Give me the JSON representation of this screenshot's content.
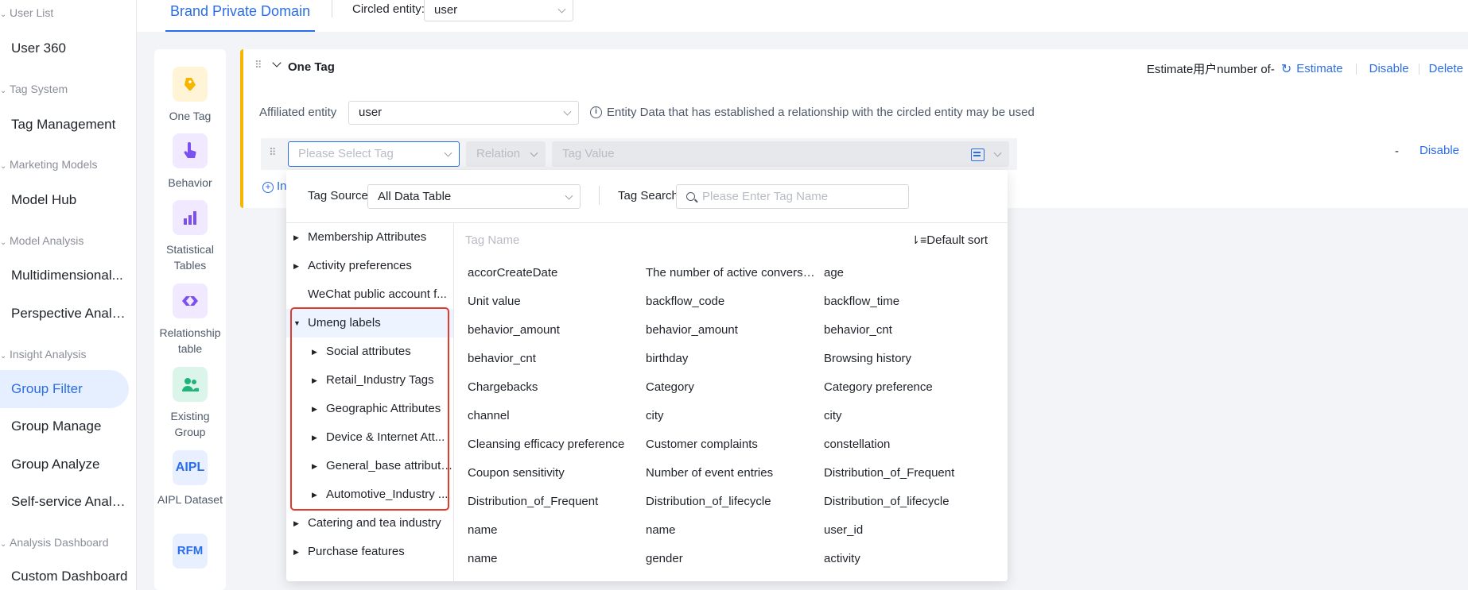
{
  "sidebar": {
    "groups": [
      {
        "label": "User List",
        "items": [
          "User 360"
        ]
      },
      {
        "label": "Tag System",
        "items": [
          "Tag Management"
        ]
      },
      {
        "label": "Marketing Models",
        "items": [
          "Model Hub"
        ]
      },
      {
        "label": "Model Analysis",
        "items": [
          "Multidimensional...",
          "Perspective Analy..."
        ]
      },
      {
        "label": "Insight Analysis",
        "items": [
          "Group Filter",
          "Group Manage",
          "Group Analyze",
          "Self-service Analy..."
        ]
      },
      {
        "label": "Analysis Dashboard",
        "items": [
          "Custom Dashboard"
        ]
      }
    ],
    "active_item": "Group Filter"
  },
  "topbar": {
    "tab": "Brand Private Domain",
    "circled_label": "Circled entity:",
    "circled_value": "user"
  },
  "tools": [
    {
      "label": "One Tag",
      "icon": "tag-icon"
    },
    {
      "label": "Behavior",
      "icon": "pointer-hand-icon"
    },
    {
      "label": "Statistical Tables",
      "icon": "bar-chart-icon"
    },
    {
      "label": "Relationship table",
      "icon": "link-icon"
    },
    {
      "label": "Existing Group",
      "icon": "group-icon"
    },
    {
      "label": "AIPL Dataset",
      "icon_text": "AIPL"
    },
    {
      "label": "RFM",
      "icon_text": "RFM"
    }
  ],
  "card": {
    "title": "One Tag",
    "estimate_prefix": "Estimate用户number of-",
    "estimate_link": "Estimate",
    "disable_link": "Disable",
    "delete_link": "Delete",
    "affiliated_label": "Affiliated entity",
    "affiliated_value": "user",
    "info_text": "Entity Data that has established a relationship with the circled entity may be used",
    "tag_placeholder": "Please Select Tag",
    "relation_placeholder": "Relation",
    "tag_value_placeholder": "Tag Value",
    "row_dash": "-",
    "row_disable": "Disable",
    "add_prefix": "In"
  },
  "dropdown": {
    "source_label": "Tag Source:",
    "source_value": "All Data Table",
    "search_label": "Tag Search:",
    "search_placeholder": "Please Enter Tag Name",
    "column_header": "Tag Name",
    "sort_label": "Default sort",
    "tree": [
      {
        "label": "Membership Attributes",
        "level": 0,
        "expand": "collapsed"
      },
      {
        "label": "Activity preferences",
        "level": 0,
        "expand": "collapsed"
      },
      {
        "label": "WeChat public account f...",
        "level": 0,
        "expand": "none"
      },
      {
        "label": "Umeng labels",
        "level": 0,
        "expand": "expanded",
        "selected": true
      },
      {
        "label": "Social attributes",
        "level": 1,
        "expand": "collapsed"
      },
      {
        "label": "Retail_Industry Tags",
        "level": 1,
        "expand": "collapsed"
      },
      {
        "label": "Geographic Attributes",
        "level": 1,
        "expand": "collapsed"
      },
      {
        "label": "Device & Internet Att...",
        "level": 1,
        "expand": "collapsed"
      },
      {
        "label": "General_base attributes",
        "level": 1,
        "expand": "collapsed"
      },
      {
        "label": "Automotive_Industry ...",
        "level": 1,
        "expand": "collapsed"
      },
      {
        "label": "Catering and tea industry",
        "level": 0,
        "expand": "collapsed"
      },
      {
        "label": "Purchase features",
        "level": 0,
        "expand": "collapsed"
      }
    ],
    "tags": [
      [
        "accorCreateDate",
        "The number of active conversi…",
        "age"
      ],
      [
        "Unit value",
        "backflow_code",
        "backflow_time"
      ],
      [
        "behavior_amount",
        "behavior_amount",
        "behavior_cnt"
      ],
      [
        "behavior_cnt",
        "birthday",
        "Browsing history"
      ],
      [
        "Chargebacks",
        "Category",
        "Category preference"
      ],
      [
        "channel",
        "city",
        "city"
      ],
      [
        "Cleansing efficacy preference",
        "Customer complaints",
        "constellation"
      ],
      [
        "Coupon sensitivity",
        "Number of event entries",
        "Distribution_of_Frequent"
      ],
      [
        "Distribution_of_Frequent",
        "Distribution_of_lifecycle",
        "Distribution_of_lifecycle"
      ],
      [
        "name",
        "name",
        "user_id"
      ],
      [
        "name",
        "gender",
        "activity"
      ]
    ]
  },
  "colors": {
    "primary": "#2b6de8",
    "card_accent": "#f7b500",
    "highlight": "#e23b2e"
  }
}
